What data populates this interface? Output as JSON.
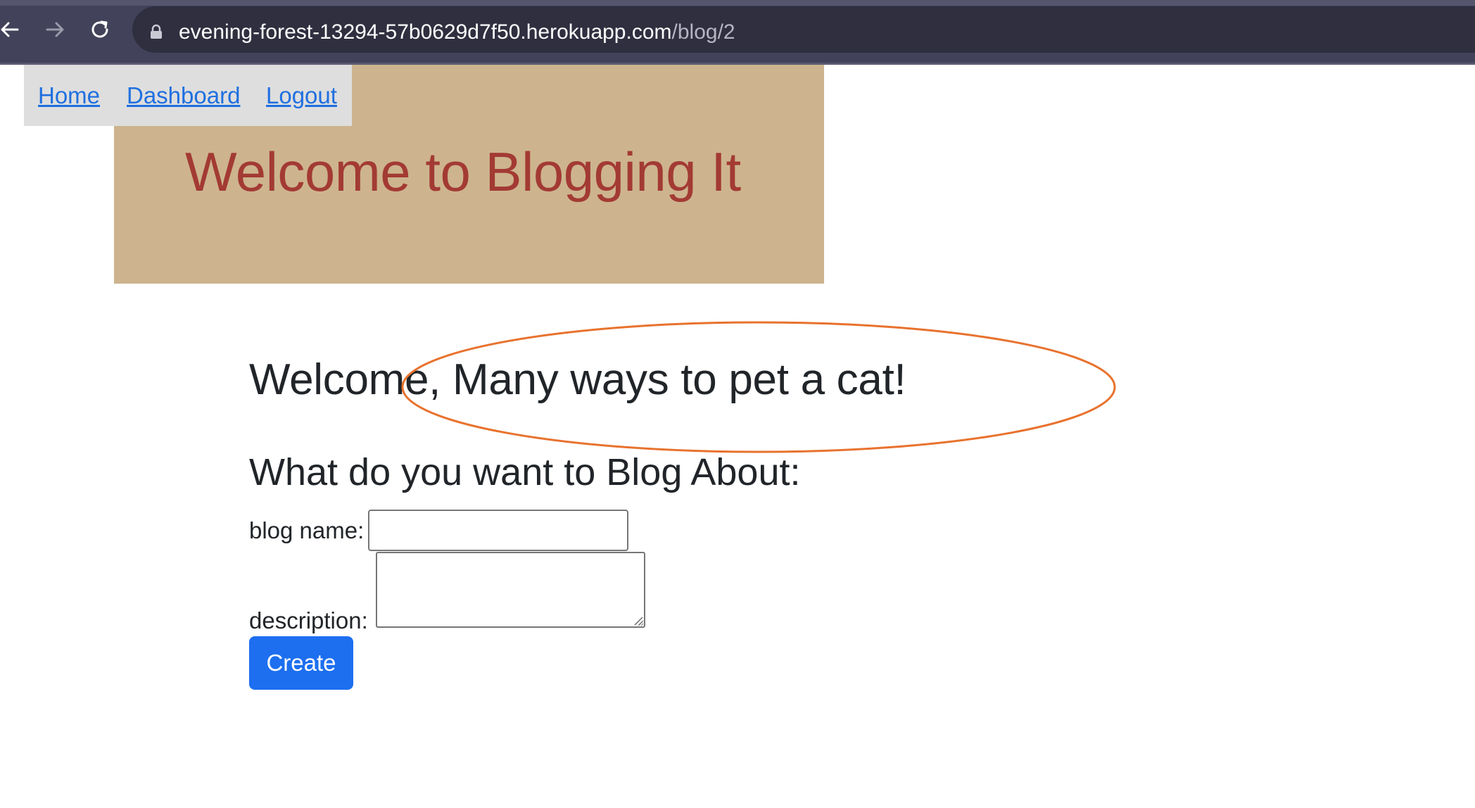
{
  "browser": {
    "url_host": "evening-forest-13294-57b0629d7f50.herokuapp.com",
    "url_path": "/blog/2",
    "icons": {
      "back": "arrow-left-icon",
      "forward": "arrow-right-icon",
      "reload": "reload-icon",
      "security": "lock-icon"
    }
  },
  "nav": {
    "items": [
      {
        "label": "Home"
      },
      {
        "label": "Dashboard"
      },
      {
        "label": "Logout"
      }
    ]
  },
  "banner": {
    "title": "Welcome to Blogging It"
  },
  "main": {
    "welcome": "Welcome, Many ways to pet a cat!",
    "section_heading": "What do you want to Blog About:"
  },
  "form": {
    "blog_name_label": "blog name:",
    "blog_name_value": "",
    "description_label": "description:",
    "description_value": "",
    "submit_label": "Create"
  },
  "colors": {
    "chrome_bg": "#42425a",
    "banner_bg": "#cdb48e",
    "banner_title": "#a33a34",
    "navbar_bg": "#dedede",
    "link": "#1f6fe0",
    "button_bg": "#1d6ff0",
    "annotation": "#e8722e"
  }
}
